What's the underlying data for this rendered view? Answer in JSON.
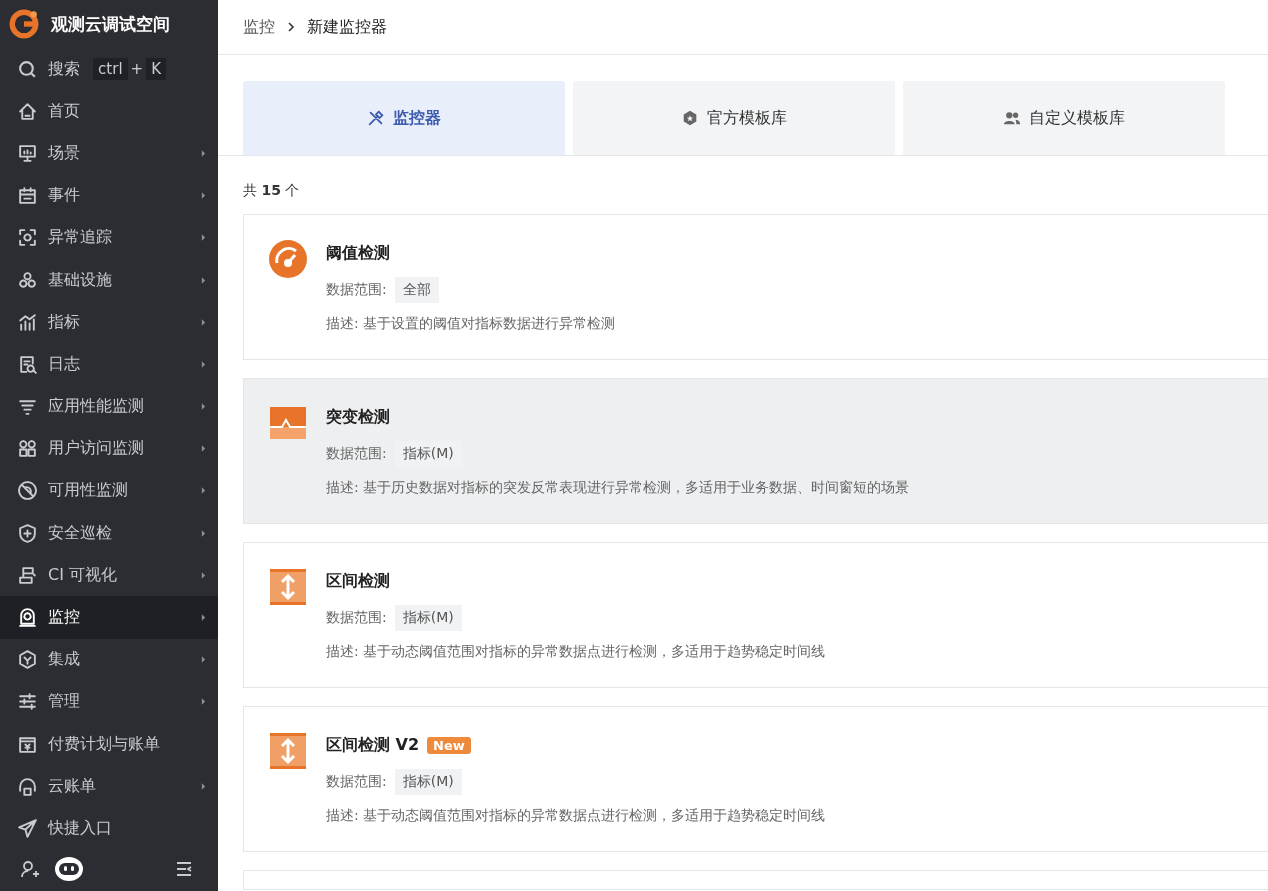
{
  "workspace": {
    "name": "观测云调试空间"
  },
  "search": {
    "label": "搜索",
    "keys": [
      "ctrl",
      "K"
    ],
    "separator": "+"
  },
  "sidebar": {
    "items": [
      {
        "label": "首页",
        "kind": "home",
        "has_arrow": false,
        "selected": false
      },
      {
        "label": "场景",
        "kind": "screen",
        "has_arrow": true,
        "selected": false
      },
      {
        "label": "事件",
        "kind": "calendar",
        "has_arrow": true,
        "selected": false
      },
      {
        "label": "异常追踪",
        "kind": "focus",
        "has_arrow": true,
        "selected": false
      },
      {
        "label": "基础设施",
        "kind": "circles",
        "has_arrow": true,
        "selected": false
      },
      {
        "label": "指标",
        "kind": "chart",
        "has_arrow": true,
        "selected": false
      },
      {
        "label": "日志",
        "kind": "doc",
        "has_arrow": true,
        "selected": false
      },
      {
        "label": "应用性能监测",
        "kind": "lines",
        "has_arrow": true,
        "selected": false
      },
      {
        "label": "用户访问监测",
        "kind": "grid",
        "has_arrow": true,
        "selected": false
      },
      {
        "label": "可用性监测",
        "kind": "ban",
        "has_arrow": true,
        "selected": false
      },
      {
        "label": "安全巡检",
        "kind": "shield",
        "has_arrow": true,
        "selected": false
      },
      {
        "label": "CI 可视化",
        "kind": "ci",
        "has_arrow": true,
        "selected": false
      },
      {
        "label": "监控",
        "kind": "camera",
        "has_arrow": true,
        "selected": true
      },
      {
        "label": "集成",
        "kind": "hex",
        "has_arrow": true,
        "selected": false
      },
      {
        "label": "管理",
        "kind": "sliders",
        "has_arrow": true,
        "selected": false
      },
      {
        "label": "付费计划与账单",
        "kind": "bill",
        "has_arrow": false,
        "selected": false
      },
      {
        "label": "云账单",
        "kind": "cloud",
        "has_arrow": true,
        "selected": false
      },
      {
        "label": "快捷入口",
        "kind": "plane",
        "has_arrow": false,
        "selected": false
      }
    ]
  },
  "breadcrumb": [
    "监控",
    "新建监控器"
  ],
  "tabs": [
    {
      "label": "监控器",
      "kind": "tools",
      "selected": true
    },
    {
      "label": "官方模板库",
      "kind": "badge",
      "selected": false
    },
    {
      "label": "自定义模板库",
      "kind": "users",
      "selected": false
    }
  ],
  "count": "共 **15** 个",
  "cards": [
    {
      "kind": "gauge",
      "title": "阈值检测",
      "scope_label": "数据范围:",
      "scope": "全部",
      "description": "描述: 基于设置的阈值对指标数据进行异常检测",
      "highlighted": false
    },
    {
      "kind": "spike",
      "title": "突变检测",
      "scope_label": "数据范围:",
      "scope": "指标(M)",
      "description": "描述: 基于历史数据对指标的突发反常表现进行异常检测，多适用于业务数据、时间窗短的场景",
      "highlighted": true
    },
    {
      "kind": "range",
      "title": "区间检测",
      "scope_label": "数据范围:",
      "scope": "指标(M)",
      "description": "描述: 基于动态阈值范围对指标的异常数据点进行检测，多适用于趋势稳定时间线",
      "highlighted": false
    },
    {
      "kind": "range",
      "title": "区间检测 V2",
      "badge": "New",
      "scope_label": "数据范围:",
      "scope": "指标(M)",
      "description": "描述: 基于动态阈值范围对指标的异常数据点进行检测，多适用于趋势稳定时间线",
      "highlighted": false
    }
  ]
}
